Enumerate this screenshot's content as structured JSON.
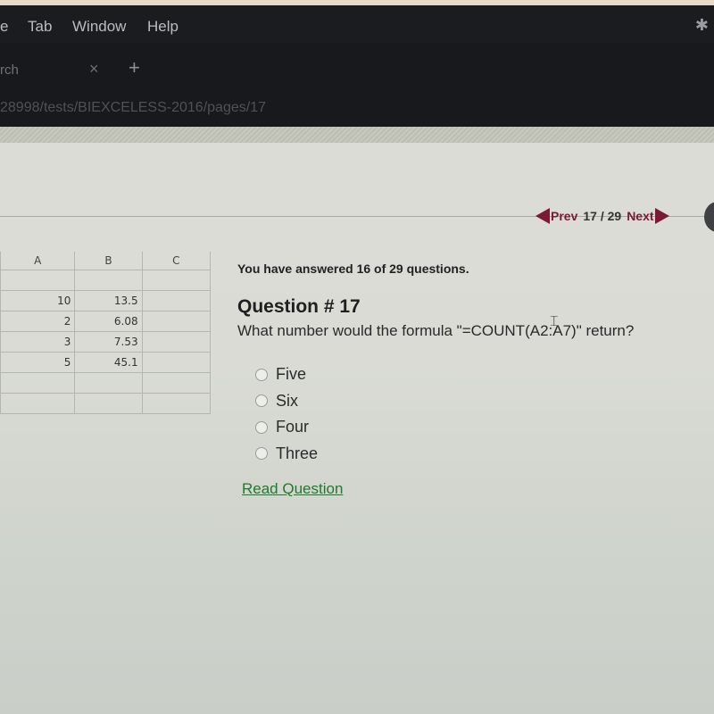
{
  "menubar": {
    "items": [
      "e",
      "Tab",
      "Window",
      "Help"
    ],
    "status_icon": "bluetooth-icon"
  },
  "browser": {
    "tab_title": "rch",
    "tab_close_glyph": "×",
    "new_tab_glyph": "+",
    "url": "28998/tests/BIEXCELESS-2016/pages/17"
  },
  "pager": {
    "prev_label": "Prev",
    "page_count": "17 / 29",
    "next_label": "Next"
  },
  "sheet": {
    "columns": [
      "A",
      "B",
      "C"
    ],
    "rows": [
      [
        "",
        "",
        ""
      ],
      [
        "10",
        "13.5",
        ""
      ],
      [
        "2",
        "6.08",
        ""
      ],
      [
        "3",
        "7.53",
        ""
      ],
      [
        "5",
        "45.1",
        ""
      ],
      [
        "",
        "",
        ""
      ],
      [
        "",
        "",
        ""
      ]
    ]
  },
  "quiz": {
    "progress_text": "You have answered 16 of 29 questions.",
    "answered": 16,
    "total": 29,
    "question_title": "Question # 17",
    "question_text": "What number would the formula \"=COUNT(A2:A7)\" return?",
    "options": [
      "Five",
      "Six",
      "Four",
      "Three"
    ],
    "selected_option": null,
    "read_question_label": "Read Question"
  },
  "colors": {
    "nav_accent": "#7a1a33",
    "link_green": "#1e7a2c",
    "chrome_dark": "#1b1c20"
  }
}
